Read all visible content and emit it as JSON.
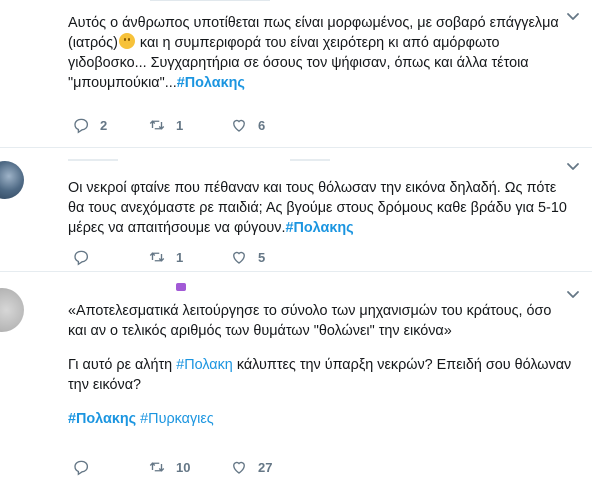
{
  "tweets": [
    {
      "lines": [
        "Αυτός ο άνθρωπος υποτίθεται πως είναι μορφωμένος, με σοβαρό επάγγελμα",
        "και η συμπεριφορά του είναι χειρότερη κι από αμόρφωτο",
        "γιδοβοσκο... Συγχαρητήρια σε όσους τον ψήφισαν, όπως και άλλα τέτοια",
        "\"μπουμπούκια\"..."
      ],
      "line2_prefix": "(ιατρός)",
      "hashtag": "#Πολακης",
      "emoji": "worried-face",
      "replies": "2",
      "retweets": "1",
      "likes": "6"
    },
    {
      "lines": [
        "Οι νεκροί φταίνε που πέθαναν και τους θόλωσαν την εικόνα δηλαδή. Ως πότε",
        "θα τους ανεχόμαστε ρε παιδιά; Ας βγούμε στους δρόμους καθε βράδυ για  5-10",
        "μέρες να απαιτήσουμε να φύγουν."
      ],
      "hashtag": "#Πολακης",
      "replies": "",
      "retweets": "1",
      "likes": "5"
    },
    {
      "lines": [
        "«Αποτελεσματικά λειτούργησε το σύνολο των μηχανισμών του κράτους, όσο",
        "και αν ο τελικός αριθμός των θυμάτων \"θολώνει\" την εικόνα»",
        "Γι αυτό ρε αλήτη",
        "κάλυπτες την ύπαρξη νεκρών? Επειδή σου θόλωναν",
        "την εικόνα?"
      ],
      "hashtag_inline": "#Πολακη",
      "hashtags": [
        "#Πολακης",
        "#Πυρκαγιες"
      ],
      "replies": "",
      "retweets": "10",
      "likes": "27"
    }
  ],
  "icons": {
    "reply": "reply-icon",
    "retweet": "retweet-icon",
    "like": "heart-icon",
    "caret": "chevron-down-icon"
  },
  "colors": {
    "link": "#1b95e0",
    "muted": "#657786",
    "divider": "#e6ecf0"
  }
}
